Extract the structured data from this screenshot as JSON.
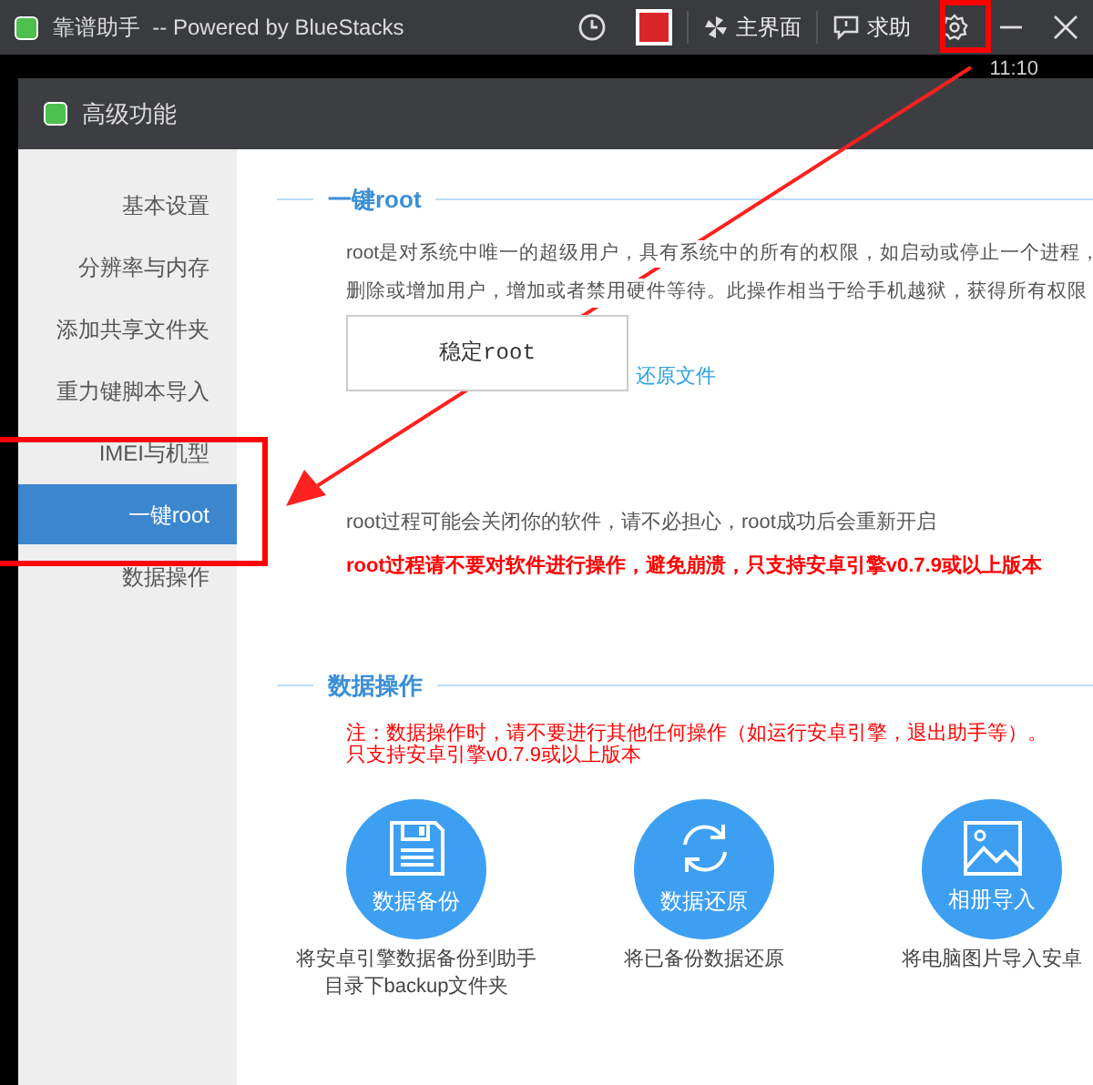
{
  "window": {
    "title": "靠谱助手  -- Powered by BlueStacks",
    "toolbar": [
      {
        "kind": "clock"
      },
      {
        "kind": "app"
      },
      {
        "kind": "home",
        "label": "主界面"
      },
      {
        "kind": "help",
        "label": "求助"
      },
      {
        "kind": "settings"
      },
      {
        "kind": "minimize"
      },
      {
        "kind": "close"
      }
    ]
  },
  "clock": "11:10",
  "dialog": {
    "title": "高级功能"
  },
  "sidebar": {
    "items": [
      {
        "label": "基本设置",
        "selected": false
      },
      {
        "label": "分辨率与内存",
        "selected": false
      },
      {
        "label": "添加共享文件夹",
        "selected": false
      },
      {
        "label": "重力键脚本导入",
        "selected": false
      },
      {
        "label": "IMEI与机型",
        "selected": false
      },
      {
        "label": "一键root",
        "selected": true
      },
      {
        "label": "数据操作",
        "selected": false
      }
    ]
  },
  "root_section": {
    "heading": "一键root",
    "description": [
      "root是对系统中唯一的超级用户，具有系统中的所有的权限，如启动或停止一个进程，",
      "删除或增加用户，增加或者禁用硬件等待。此操作相当于给手机越狱，获得所有权限"
    ],
    "button": "稳定root",
    "link": "还原文件",
    "note": "root过程可能会关闭你的软件，请不必担心，root成功后会重新开启",
    "warning": "root过程请不要对软件进行操作，避免崩溃，只支持安卓引擎v0.7.9或以上版本"
  },
  "data_section": {
    "heading": "数据操作",
    "warnings": [
      "注：数据操作时，请不要进行其他任何操作（如运行安卓引擎，退出助手等）。",
      "只支持安卓引擎v0.7.9或以上版本"
    ],
    "actions": [
      {
        "kind": "backup",
        "label": "数据备份",
        "caption": [
          "将安卓引擎数据备份到助手",
          "目录下backup文件夹"
        ]
      },
      {
        "kind": "restore",
        "label": "数据还原",
        "caption": [
          "将已备份数据还原"
        ]
      },
      {
        "kind": "photos",
        "label": "相册导入",
        "caption": [
          "将电脑图片导入安卓"
        ]
      }
    ]
  }
}
